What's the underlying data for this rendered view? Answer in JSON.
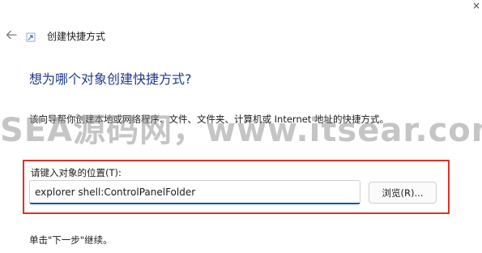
{
  "window": {
    "title": "创建快捷方式",
    "close_glyph": "×"
  },
  "icons": {
    "back": "back-arrow-icon",
    "app": "shortcut-app-icon",
    "close": "close-icon"
  },
  "main": {
    "heading": "想为哪个对象创建快捷方式?",
    "description": "该向导帮你创建本地或网络程序、文件、文件夹、计算机或 Internet 地址的快捷方式。",
    "location_label": "请键入对象的位置(T):",
    "location_value": "explorer shell:ControlPanelFolder",
    "browse_label": "浏览(R)...",
    "instruction": "单击\"下一步\"继续。"
  },
  "watermark": {
    "text": "SEA源码网，www.itsear.com"
  },
  "colors": {
    "heading": "#1f3a8c",
    "highlight_border": "#d9342b",
    "input_underline": "#0a58a8"
  }
}
